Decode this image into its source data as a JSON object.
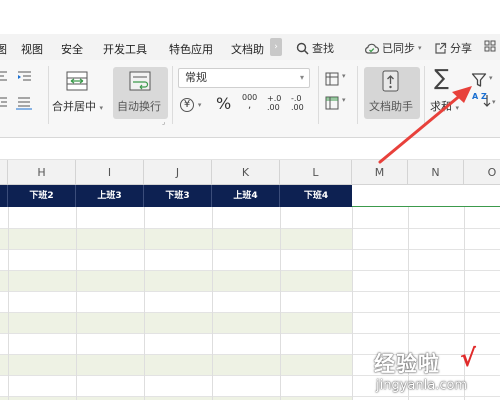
{
  "menubar": {
    "tabs": [
      "图",
      "视图",
      "安全",
      "开发工具",
      "特色应用",
      "文档助"
    ],
    "scroll_arrow": "›",
    "search_label": "查找",
    "sync_label": "已同步",
    "share_label": "分享"
  },
  "ribbon": {
    "merge_center_label": "合并居中",
    "auto_wrap_label": "自动换行",
    "number_format_value": "常规",
    "currency_symbol": "¥",
    "percent_symbol": "%",
    "thousands_label": "000",
    "inc_decimal_label": "+.0",
    "dec_decimal_label": "-.0",
    "doc_helper_label": "文档助手",
    "sum_label": "求和",
    "sort_label": "A Z"
  },
  "sheet": {
    "column_letters": [
      "H",
      "I",
      "J",
      "K",
      "L",
      "M",
      "N",
      "O"
    ],
    "header_cells": [
      "下班2",
      "上班3",
      "下班3",
      "上班4",
      "下班4"
    ],
    "header_bg": "#0d2152",
    "band_color": "#eef2e4"
  },
  "annotation": {
    "arrow_color": "#e8413b"
  },
  "watermark": {
    "main_text": "经验啦",
    "check": "√",
    "url": "jingyanla.com"
  },
  "icons": [
    "merge-icon",
    "wrap-icon",
    "currency-icon",
    "doc-helper-icon",
    "sum-icon",
    "filter-icon",
    "sort-icon",
    "search-icon",
    "cloud-sync-icon",
    "share-icon",
    "grid-icon"
  ]
}
